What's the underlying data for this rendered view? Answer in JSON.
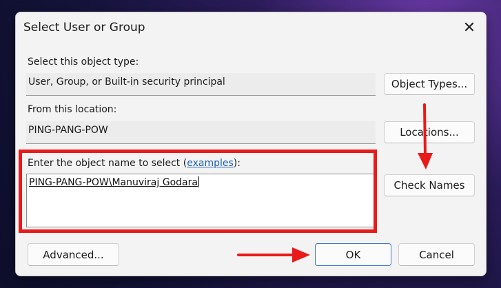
{
  "dialog": {
    "title": "Select User or Group",
    "close_icon": "close-icon"
  },
  "object_type": {
    "label": "Select this object type:",
    "value": "User, Group, or Built-in security principal",
    "button": "Object Types..."
  },
  "location": {
    "label": "From this location:",
    "value": "PING-PANG-POW",
    "button": "Locations..."
  },
  "object_name": {
    "label_prefix": "Enter the object name to select (",
    "label_link": "examples",
    "label_suffix": "):",
    "value": "PING-PANG-POW\\Manuviraj Godara",
    "check_button": "Check Names"
  },
  "footer": {
    "advanced_button": "Advanced...",
    "ok_button": "OK",
    "cancel_button": "Cancel"
  },
  "annotations": {
    "highlight_color": "#e81a1a"
  }
}
